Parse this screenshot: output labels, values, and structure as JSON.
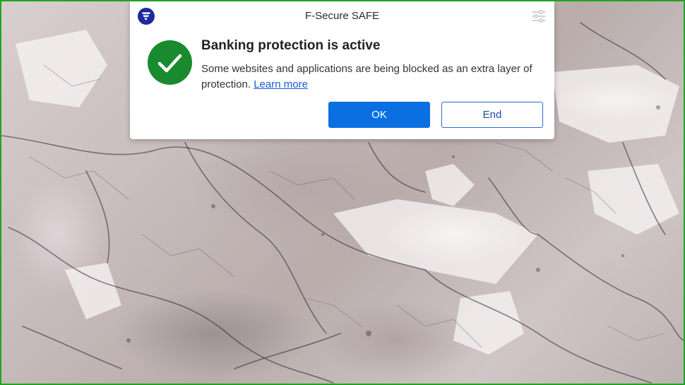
{
  "dialog": {
    "app_title": "F-Secure SAFE",
    "app_logo_icon": "f-secure-shield-icon",
    "settings_icon": "sliders-icon",
    "status_icon": "checkmark-circle-icon",
    "status_color": "#1a8a2e",
    "headline": "Banking protection is active",
    "message_text": "Some websites and applications are being blocked as an extra layer of protection. ",
    "learn_more_label": "Learn more",
    "ok_label": "OK",
    "end_label": "End",
    "accent_color": "#0a6fe0"
  },
  "desktop": {
    "wallpaper": "marble-texture",
    "frame_color": "#1ea51e"
  }
}
